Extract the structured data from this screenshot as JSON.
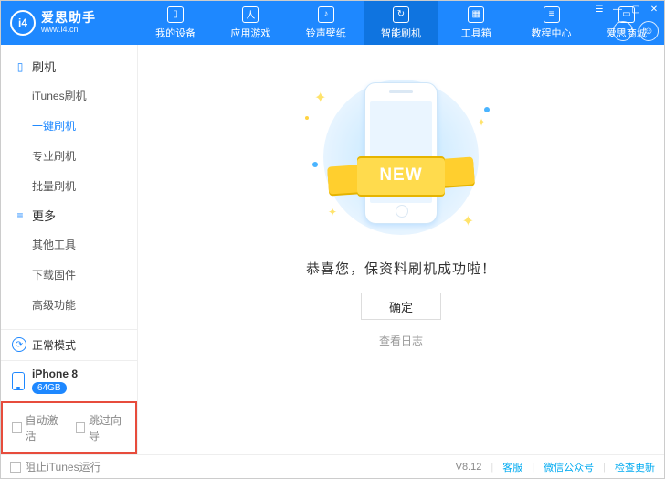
{
  "app": {
    "name": "爱思助手",
    "site": "www.i4.cn",
    "version": "V8.12"
  },
  "header_tabs": [
    {
      "label": "我的设备"
    },
    {
      "label": "应用游戏"
    },
    {
      "label": "铃声壁纸"
    },
    {
      "label": "智能刷机"
    },
    {
      "label": "工具箱"
    },
    {
      "label": "教程中心"
    },
    {
      "label": "爱思商城"
    }
  ],
  "sidebar": {
    "sec1_title": "刷机",
    "sec1_items": [
      "iTunes刷机",
      "一键刷机",
      "专业刷机",
      "批量刷机"
    ],
    "sec2_title": "更多",
    "sec2_items": [
      "其他工具",
      "下载固件",
      "高级功能"
    ]
  },
  "mode": "正常模式",
  "device": {
    "name": "iPhone 8",
    "storage": "64GB"
  },
  "checkboxes": {
    "auto_activate": "自动激活",
    "skip_guide": "跳过向导"
  },
  "main": {
    "ribbon": "NEW",
    "message": "恭喜您，保资料刷机成功啦！",
    "ok_btn": "确定",
    "view_log": "查看日志"
  },
  "status": {
    "block_itunes": "阻止iTunes运行",
    "support": "客服",
    "wechat": "微信公众号",
    "update": "检查更新"
  }
}
